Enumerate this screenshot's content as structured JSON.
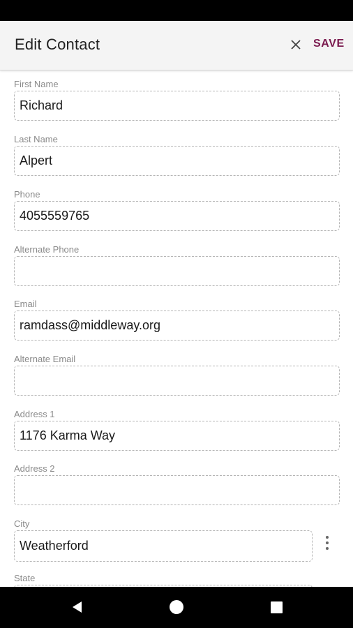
{
  "header": {
    "title": "Edit Contact",
    "close_icon": "close-icon",
    "save_label": "SAVE",
    "accent_color": "#7a1a4e"
  },
  "fields": {
    "first_name": {
      "label": "First Name",
      "value": "Richard"
    },
    "last_name": {
      "label": "Last Name",
      "value": "Alpert"
    },
    "phone": {
      "label": "Phone",
      "value": "4055559765"
    },
    "alt_phone": {
      "label": "Alternate Phone",
      "value": ""
    },
    "email": {
      "label": "Email",
      "value": "ramdass@middleway.org"
    },
    "alt_email": {
      "label": "Alternate Email",
      "value": ""
    },
    "address1": {
      "label": "Address 1",
      "value": "1176 Karma Way"
    },
    "address2": {
      "label": "Address 2",
      "value": ""
    },
    "city": {
      "label": "City",
      "value": "Weatherford"
    },
    "state": {
      "label": "State",
      "value": ""
    }
  },
  "icons": {
    "more": "more-vert-icon",
    "back": "back-triangle-icon",
    "home": "home-circle-icon",
    "recents": "recents-square-icon"
  }
}
